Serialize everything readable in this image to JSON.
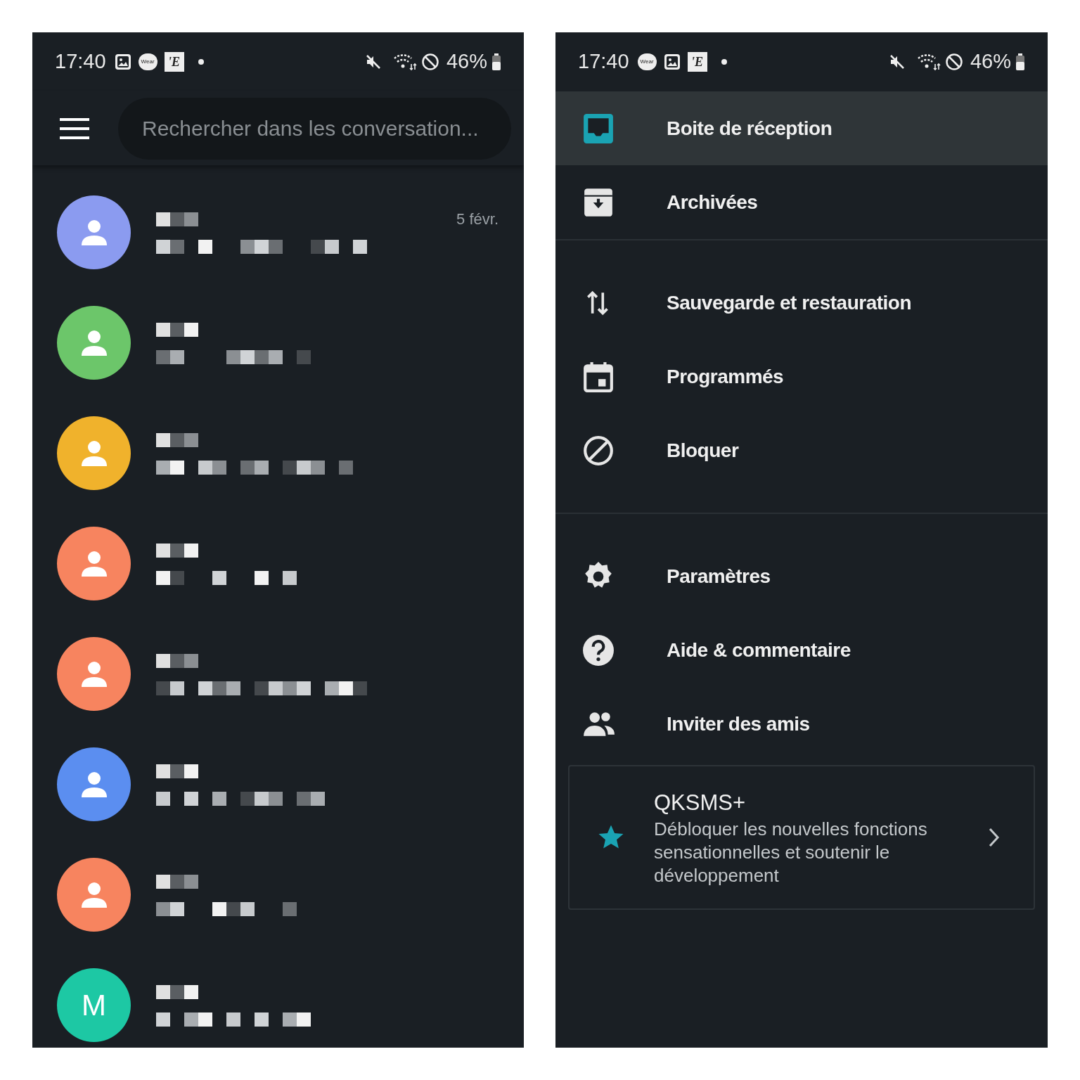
{
  "left_phone": {
    "status_bar": {
      "time": "17:40",
      "apps": [
        {
          "kind": "gallery"
        },
        {
          "kind": "wear",
          "label": "Wear"
        },
        {
          "kind": "news",
          "label": "'E"
        },
        {
          "kind": "dot"
        }
      ],
      "battery": "46%"
    },
    "search": {
      "placeholder": "Rechercher dans les conversation..."
    },
    "conversations": [
      {
        "color": "#8b9bf0",
        "date": "5 févr."
      },
      {
        "color": "#6cc66a"
      },
      {
        "color": "#f0b22c"
      },
      {
        "color": "#f7845f"
      },
      {
        "color": "#f7845f"
      },
      {
        "color": "#5b8ef0"
      },
      {
        "color": "#f7845f"
      },
      {
        "color": "#1dc8a4",
        "initial": "M"
      }
    ]
  },
  "right_phone": {
    "status_bar": {
      "time": "17:40",
      "apps": [
        {
          "kind": "wear",
          "label": "Wear"
        },
        {
          "kind": "gallery"
        },
        {
          "kind": "news",
          "label": "'E"
        },
        {
          "kind": "dot"
        }
      ],
      "battery": "46%"
    },
    "drawer_sections": [
      [
        {
          "kind": "inbox",
          "label": "Boite de réception",
          "selected": true
        },
        {
          "kind": "archive",
          "label": "Archivées",
          "selected": false
        }
      ],
      [
        {
          "kind": "backup",
          "label": "Sauvegarde et restauration",
          "selected": false
        },
        {
          "kind": "scheduled",
          "label": "Programmés",
          "selected": false
        },
        {
          "kind": "block",
          "label": "Bloquer",
          "selected": false
        }
      ],
      [
        {
          "kind": "settings",
          "label": "Paramètres",
          "selected": false
        },
        {
          "kind": "help",
          "label": "Aide & commentaire",
          "selected": false
        },
        {
          "kind": "invite",
          "label": "Inviter des amis",
          "selected": false
        }
      ]
    ],
    "promo": {
      "title": "QKSMS+",
      "description": "Débloquer les nouvelles fonctions sensationnelles et soutenir le développement"
    }
  }
}
